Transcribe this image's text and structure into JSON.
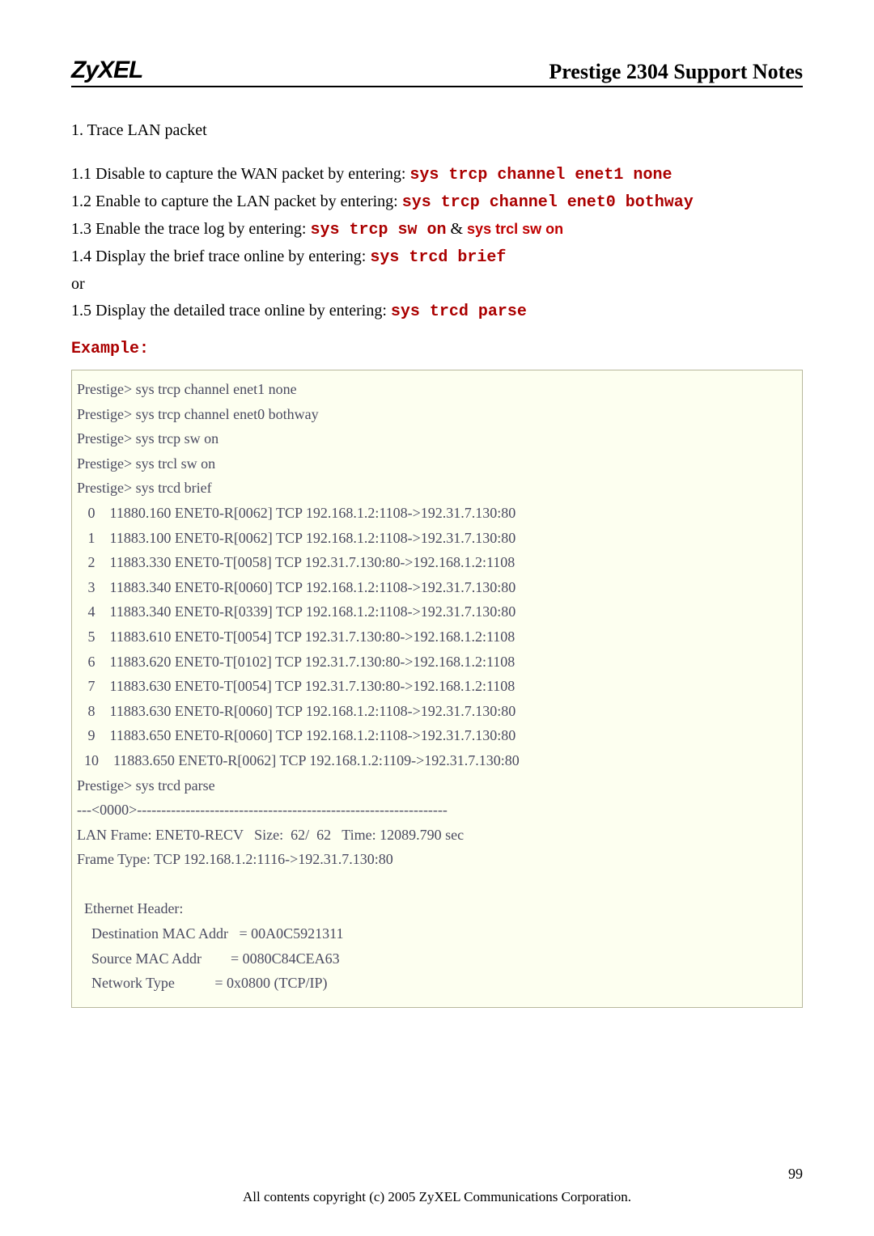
{
  "header": {
    "logo": "ZyXEL",
    "title": "Prestige 2304 Support Notes"
  },
  "section_title": "1. Trace LAN packet",
  "steps": {
    "line1_pre": "1.1 Disable to capture the WAN packet by entering: ",
    "line1_cmd": "sys trcp channel enet1 none",
    "line2_pre": "1.2 Enable to capture the LAN packet by entering: ",
    "line2_cmd": "sys trcp channel enet0 bothway",
    "line3_pre": "1.3 Enable the trace log by entering: ",
    "line3_cmd": "sys trcp sw on",
    "line3_mid": " & ",
    "line3_cmd2": "sys trcl sw on",
    "line4_pre": "1.4 Display the brief trace online by entering: ",
    "line4_cmd": "sys trcd brief",
    "or": "or",
    "line5_pre": "1.5 Display the detailed trace online by entering: ",
    "line5_cmd": "sys trcd parse"
  },
  "example_label": "Example:",
  "code": "Prestige> sys trcp channel enet1 none\nPrestige> sys trcp channel enet0 bothway\nPrestige> sys trcp sw on\nPrestige> sys trcl sw on\nPrestige> sys trcd brief\n   0    11880.160 ENET0-R[0062] TCP 192.168.1.2:1108->192.31.7.130:80\n   1    11883.100 ENET0-R[0062] TCP 192.168.1.2:1108->192.31.7.130:80\n   2    11883.330 ENET0-T[0058] TCP 192.31.7.130:80->192.168.1.2:1108\n   3    11883.340 ENET0-R[0060] TCP 192.168.1.2:1108->192.31.7.130:80\n   4    11883.340 ENET0-R[0339] TCP 192.168.1.2:1108->192.31.7.130:80\n   5    11883.610 ENET0-T[0054] TCP 192.31.7.130:80->192.168.1.2:1108\n   6    11883.620 ENET0-T[0102] TCP 192.31.7.130:80->192.168.1.2:1108\n   7    11883.630 ENET0-T[0054] TCP 192.31.7.130:80->192.168.1.2:1108\n   8    11883.630 ENET0-R[0060] TCP 192.168.1.2:1108->192.31.7.130:80\n   9    11883.650 ENET0-R[0060] TCP 192.168.1.2:1108->192.31.7.130:80\n  10    11883.650 ENET0-R[0062] TCP 192.168.1.2:1109->192.31.7.130:80\nPrestige> sys trcd parse\n---<0000>----------------------------------------------------------------\nLAN Frame: ENET0-RECV   Size:  62/  62   Time: 12089.790 sec\nFrame Type: TCP 192.168.1.2:1116->192.31.7.130:80\n\n  Ethernet Header:\n    Destination MAC Addr   = 00A0C5921311\n    Source MAC Addr        = 0080C84CEA63\n    Network Type           = 0x0800 (TCP/IP)\n",
  "footer": {
    "page": "99",
    "copyright": "All contents copyright (c) 2005 ZyXEL Communications Corporation."
  }
}
